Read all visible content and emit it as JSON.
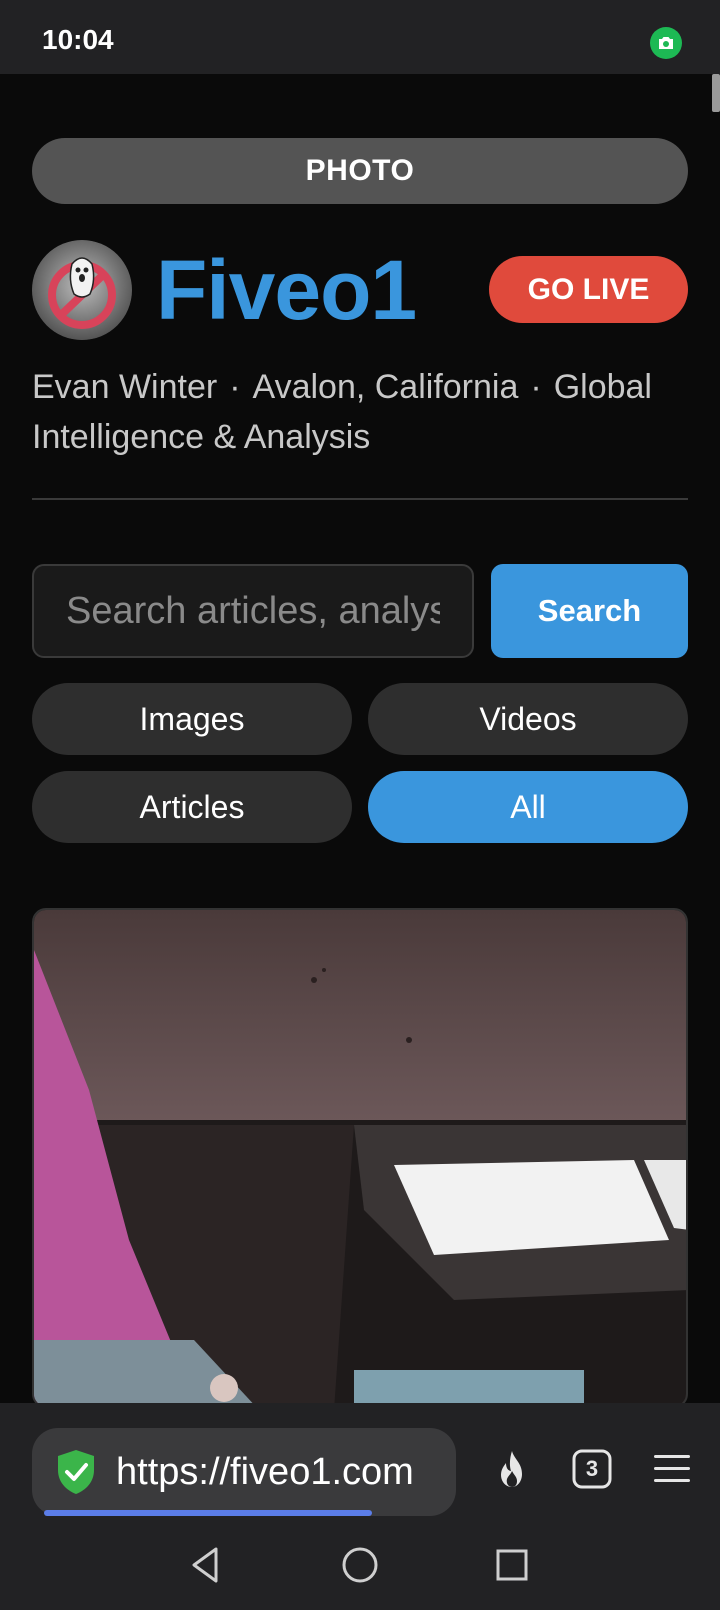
{
  "status_bar": {
    "time": "10:04",
    "indicator_icon": "camera-icon",
    "indicator_color": "#1db954"
  },
  "header": {
    "section_label": "PHOTO",
    "brand_name": "Fiveo1",
    "brand_color": "#3a96dd",
    "go_live_label": "GO LIVE",
    "go_live_color": "#e04a3c",
    "byline": {
      "author": "Evan Winter",
      "location": "Avalon, California",
      "topic": "Global Intelligence & Analysis",
      "separator": "·"
    }
  },
  "search": {
    "placeholder": "Search articles, analysis",
    "value": "",
    "button_label": "Search"
  },
  "filters": {
    "images": "Images",
    "videos": "Videos",
    "articles": "Articles",
    "all": "All",
    "active": "All"
  },
  "browser": {
    "url": "https://fiveo1.com",
    "tab_count": "3",
    "icons": [
      "shield-check-icon",
      "flame-icon",
      "tabs-icon",
      "menu-icon"
    ]
  },
  "system_nav": {
    "icons": [
      "back-icon",
      "home-icon",
      "recents-icon"
    ]
  }
}
